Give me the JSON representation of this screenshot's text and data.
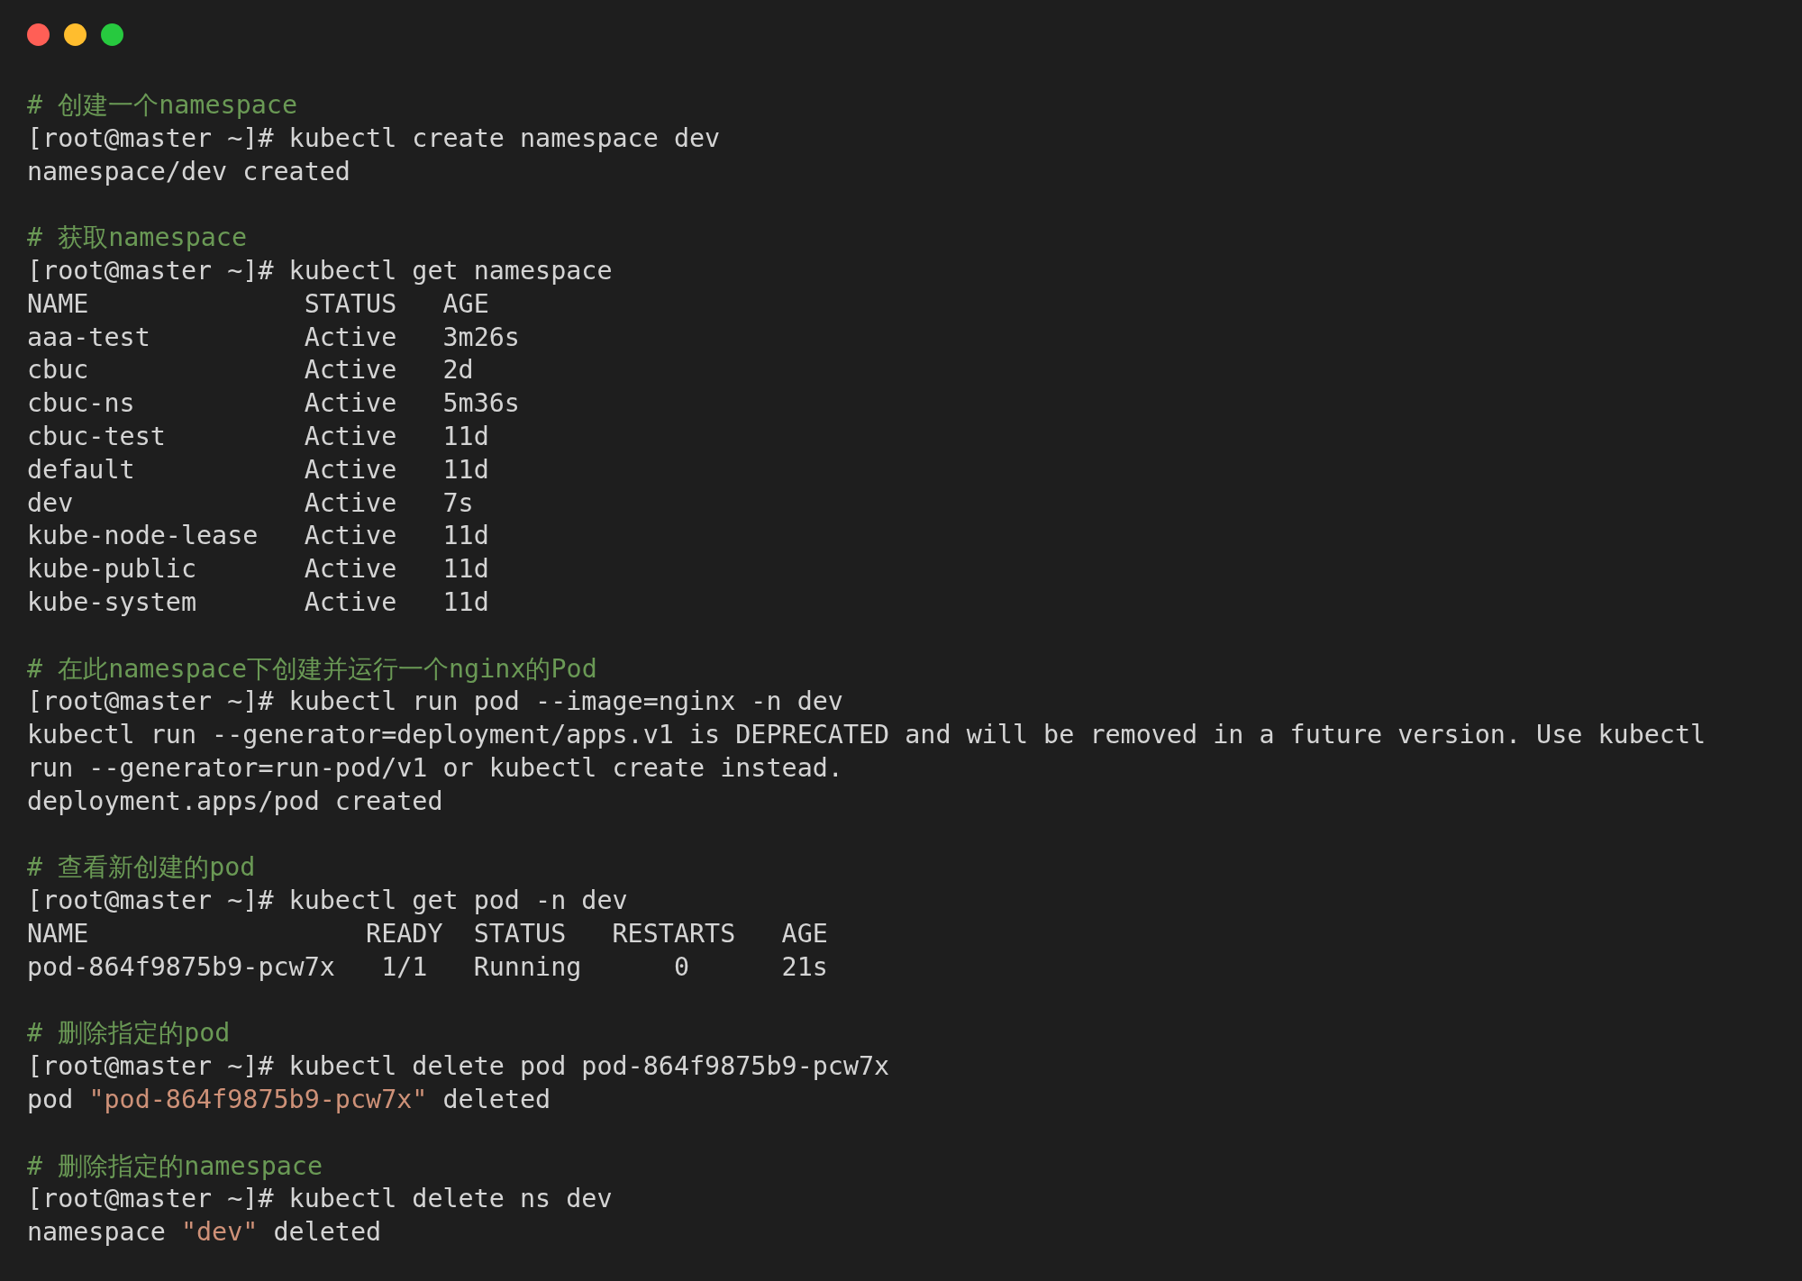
{
  "window": {
    "controls": [
      {
        "color": "#ff5f56"
      },
      {
        "color": "#ffbd2e"
      },
      {
        "color": "#27c93f"
      }
    ]
  },
  "terminal": {
    "lines": [
      {
        "kind": "comment",
        "text": "# 创建一个namespace"
      },
      {
        "kind": "command",
        "text": "[root@master ~]# kubectl create namespace dev"
      },
      {
        "kind": "output",
        "parts": [
          {
            "kind": "plain",
            "text": "namespace/dev created"
          }
        ]
      },
      {
        "kind": "blank"
      },
      {
        "kind": "comment",
        "text": "# 获取namespace"
      },
      {
        "kind": "command",
        "text": "[root@master ~]# kubectl get namespace"
      },
      {
        "kind": "output",
        "parts": [
          {
            "kind": "plain",
            "text": "NAME              STATUS   AGE"
          }
        ]
      },
      {
        "kind": "output",
        "parts": [
          {
            "kind": "plain",
            "text": "aaa-test          Active   3m26s"
          }
        ]
      },
      {
        "kind": "output",
        "parts": [
          {
            "kind": "plain",
            "text": "cbuc              Active   2d"
          }
        ]
      },
      {
        "kind": "output",
        "parts": [
          {
            "kind": "plain",
            "text": "cbuc-ns           Active   5m36s"
          }
        ]
      },
      {
        "kind": "output",
        "parts": [
          {
            "kind": "plain",
            "text": "cbuc-test         Active   11d"
          }
        ]
      },
      {
        "kind": "output",
        "parts": [
          {
            "kind": "plain",
            "text": "default           Active   11d"
          }
        ]
      },
      {
        "kind": "output",
        "parts": [
          {
            "kind": "plain",
            "text": "dev               Active   7s"
          }
        ]
      },
      {
        "kind": "output",
        "parts": [
          {
            "kind": "plain",
            "text": "kube-node-lease   Active   11d"
          }
        ]
      },
      {
        "kind": "output",
        "parts": [
          {
            "kind": "plain",
            "text": "kube-public       Active   11d"
          }
        ]
      },
      {
        "kind": "output",
        "parts": [
          {
            "kind": "plain",
            "text": "kube-system       Active   11d"
          }
        ]
      },
      {
        "kind": "blank"
      },
      {
        "kind": "comment",
        "text": "# 在此namespace下创建并运行一个nginx的Pod"
      },
      {
        "kind": "command",
        "text": "[root@master ~]# kubectl run pod --image=nginx -n dev"
      },
      {
        "kind": "output",
        "parts": [
          {
            "kind": "plain",
            "text": "kubectl run --generator=deployment/apps.v1 is DEPRECATED and will be removed in a future version. Use kubectl"
          }
        ]
      },
      {
        "kind": "output",
        "parts": [
          {
            "kind": "plain",
            "text": "run --generator=run-pod/v1 or kubectl create instead."
          }
        ]
      },
      {
        "kind": "output",
        "parts": [
          {
            "kind": "plain",
            "text": "deployment.apps/pod created"
          }
        ]
      },
      {
        "kind": "blank"
      },
      {
        "kind": "comment",
        "text": "# 查看新创建的pod"
      },
      {
        "kind": "command",
        "text": "[root@master ~]# kubectl get pod -n dev"
      },
      {
        "kind": "output",
        "parts": [
          {
            "kind": "plain",
            "text": "NAME                  READY  STATUS   RESTARTS   AGE"
          }
        ]
      },
      {
        "kind": "output",
        "parts": [
          {
            "kind": "plain",
            "text": "pod-864f9875b9-pcw7x   1/1   Running      0      21s"
          }
        ]
      },
      {
        "kind": "blank"
      },
      {
        "kind": "comment",
        "text": "# 删除指定的pod"
      },
      {
        "kind": "command",
        "text": "[root@master ~]# kubectl delete pod pod-864f9875b9-pcw7x"
      },
      {
        "kind": "output",
        "parts": [
          {
            "kind": "plain",
            "text": "pod "
          },
          {
            "kind": "string",
            "text": "\"pod-864f9875b9-pcw7x\""
          },
          {
            "kind": "plain",
            "text": " deleted"
          }
        ]
      },
      {
        "kind": "blank"
      },
      {
        "kind": "comment",
        "text": "# 删除指定的namespace"
      },
      {
        "kind": "command",
        "text": "[root@master ~]# kubectl delete ns dev"
      },
      {
        "kind": "output",
        "parts": [
          {
            "kind": "plain",
            "text": "namespace "
          },
          {
            "kind": "string",
            "text": "\"dev\""
          },
          {
            "kind": "plain",
            "text": " deleted"
          }
        ]
      }
    ]
  }
}
